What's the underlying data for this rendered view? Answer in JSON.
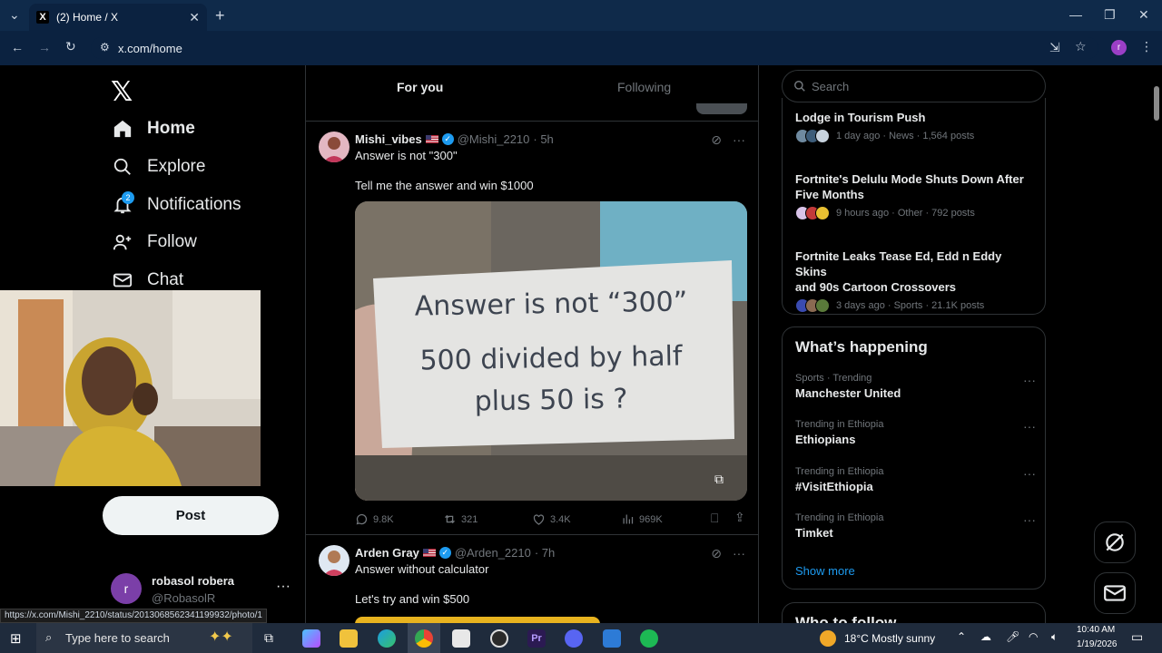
{
  "browser": {
    "tab_title": "(2) Home / X",
    "url": "x.com/home",
    "profile_initial": "r",
    "status_url": "https://x.com/Mishi_2210/status/2013068562341199932/photo/1"
  },
  "nav": {
    "home": "Home",
    "explore": "Explore",
    "notifications": "Notifications",
    "notifications_badge": "2",
    "follow": "Follow",
    "chat": "Chat",
    "post": "Post"
  },
  "account": {
    "initial": "r",
    "name": "robasol robera",
    "handle": "@RobasolR"
  },
  "feed": {
    "tab_for_you": "For you",
    "tab_following": "Following",
    "tweets": [
      {
        "name": "Mishi_vibes",
        "handle": "@Mishi_2210",
        "time": "· 5h",
        "text1": "Answer is not \"300\"",
        "text2": "Tell me the answer and win $1000",
        "card_line1": "Answer is not “300”",
        "card_line2": "500 divided by half",
        "card_line3": "plus 50 is ?",
        "replies": "9.8K",
        "reposts": "321",
        "likes": "3.4K",
        "views": "969K"
      },
      {
        "name": "Arden Gray",
        "handle": "@Arden_2210",
        "time": "· 7h",
        "text1": "Answer without calculator",
        "text2": "Let's try and win $500"
      }
    ]
  },
  "right": {
    "search_placeholder": "Search",
    "news": [
      {
        "title_line1": "Lodge in Tourism Push",
        "title_line2": "",
        "meta": "1 day ago · News · 1,564 posts"
      },
      {
        "title_line1": "Fortnite's Delulu Mode Shuts Down After",
        "title_line2": "Five Months",
        "meta": "9 hours ago · Other · 792 posts"
      },
      {
        "title_line1": "Fortnite Leaks Tease Ed, Edd n Eddy Skins",
        "title_line2": "and 90s Cartoon Crossovers",
        "meta": "3 days ago · Sports · 21.1K posts"
      }
    ],
    "whats_happening": "What’s happening",
    "trends": [
      {
        "context": "Sports · Trending",
        "title": "Manchester United"
      },
      {
        "context": "Trending in Ethiopia",
        "title": "Ethiopians"
      },
      {
        "context": "Trending in Ethiopia",
        "title": "#VisitEthiopia"
      },
      {
        "context": "Trending in Ethiopia",
        "title": "Timket"
      }
    ],
    "show_more": "Show more",
    "who_to_follow": "Who to follow"
  },
  "taskbar": {
    "search_placeholder": "Type here to search",
    "weather": "18°C  Mostly sunny",
    "time": "10:40 AM",
    "date": "1/19/2026"
  },
  "colors": {
    "accent": "#1d9bf0",
    "browser_frame": "#0f2a4a",
    "taskbar": "#1f2b3c"
  }
}
